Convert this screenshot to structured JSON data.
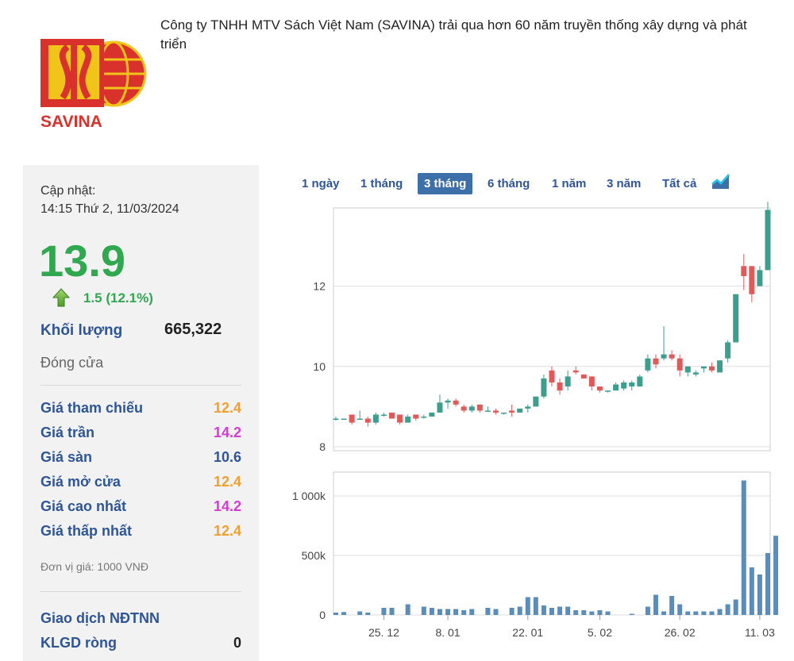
{
  "company": {
    "logo_text": "SAVINA",
    "description": "Công ty TNHH MTV Sách Việt Nam (SAVINA) trải qua hơn 60 năm truyền thống xây dựng và phát triển"
  },
  "quote": {
    "update_label": "Cập nhật:",
    "update_time": "14:15 Thứ 2, 11/03/2024",
    "price": "13.9",
    "change": "1.5 (12.1%)",
    "volume_label": "Khối lượng",
    "volume_value": "665,322",
    "close_label": "Đóng cửa",
    "rows": [
      {
        "label": "Giá tham chiếu",
        "value": "12.4",
        "color": "#f0a030"
      },
      {
        "label": "Giá trần",
        "value": "14.2",
        "color": "#d63bd6"
      },
      {
        "label": "Giá sàn",
        "value": "10.6",
        "color": "#2f5597"
      },
      {
        "label": "Giá mở cửa",
        "value": "12.4",
        "color": "#f0a030"
      },
      {
        "label": "Giá cao nhất",
        "value": "14.2",
        "color": "#d63bd6"
      },
      {
        "label": "Giá thấp nhất",
        "value": "12.4",
        "color": "#f0a030"
      }
    ],
    "unit": "Đơn vị giá: 1000 VNĐ",
    "foreign": {
      "title": "Giao dịch NĐTNN",
      "net_label": "KLGD ròng",
      "net_value": "0"
    }
  },
  "tabs": [
    "1 ngày",
    "1 tháng",
    "3 tháng",
    "6 tháng",
    "1 năm",
    "3 năm",
    "Tất cả"
  ],
  "active_tab": "3 tháng",
  "chart_type_icon": "area-chart-icon",
  "colors": {
    "up": "#3e9e8e",
    "down": "#e05a5a",
    "volume": "#5b8db8",
    "price_up": "#2fa84f"
  },
  "chart_data": {
    "type": "candlestick",
    "price_axis": {
      "ticks": [
        "8",
        "10",
        "12"
      ],
      "ylim": [
        7.9,
        13.95
      ]
    },
    "volume_axis": {
      "ticks": [
        "0",
        "500k",
        "1 000k"
      ],
      "ylim": [
        0,
        1200000
      ]
    },
    "date_ticks": [
      {
        "label": "25. 12",
        "index": 6
      },
      {
        "label": "8. 01",
        "index": 14
      },
      {
        "label": "22. 01",
        "index": 24
      },
      {
        "label": "5. 02",
        "index": 33
      },
      {
        "label": "26. 02",
        "index": 43
      },
      {
        "label": "11. 03",
        "index": 53
      }
    ],
    "candles": [
      [
        8.7,
        8.75,
        8.65,
        8.7
      ],
      [
        8.7,
        8.7,
        8.7,
        8.7
      ],
      [
        8.8,
        8.8,
        8.55,
        8.6
      ],
      [
        8.7,
        8.9,
        8.7,
        8.7
      ],
      [
        8.7,
        8.75,
        8.5,
        8.6
      ],
      [
        8.6,
        8.85,
        8.55,
        8.8
      ],
      [
        8.8,
        8.85,
        8.75,
        8.8
      ],
      [
        8.85,
        8.85,
        8.7,
        8.7
      ],
      [
        8.8,
        8.8,
        8.55,
        8.6
      ],
      [
        8.6,
        8.8,
        8.6,
        8.75
      ],
      [
        8.8,
        8.8,
        8.65,
        8.7
      ],
      [
        8.75,
        8.8,
        8.7,
        8.75
      ],
      [
        8.75,
        8.85,
        8.75,
        8.85
      ],
      [
        8.85,
        9.3,
        8.85,
        9.1
      ],
      [
        9.1,
        9.2,
        8.95,
        9.15
      ],
      [
        9.15,
        9.2,
        9.0,
        9.05
      ],
      [
        9.0,
        9.05,
        8.85,
        8.9
      ],
      [
        8.9,
        9.05,
        8.85,
        9.0
      ],
      [
        9.05,
        9.05,
        8.85,
        8.9
      ],
      [
        8.9,
        9.0,
        8.9,
        8.9
      ],
      [
        8.9,
        8.95,
        8.8,
        8.85
      ],
      [
        8.85,
        8.85,
        8.8,
        8.85
      ],
      [
        8.9,
        9.05,
        8.75,
        8.85
      ],
      [
        8.85,
        8.95,
        8.85,
        8.95
      ],
      [
        8.95,
        9.05,
        8.85,
        9.0
      ],
      [
        9.0,
        9.25,
        9.0,
        9.25
      ],
      [
        9.25,
        9.8,
        9.2,
        9.7
      ],
      [
        9.9,
        10.0,
        9.5,
        9.6
      ],
      [
        9.6,
        9.7,
        9.3,
        9.4
      ],
      [
        9.5,
        9.9,
        9.4,
        9.75
      ],
      [
        9.9,
        10.0,
        9.8,
        9.85
      ],
      [
        9.8,
        9.8,
        9.7,
        9.7
      ],
      [
        9.75,
        9.75,
        9.4,
        9.5
      ],
      [
        9.5,
        9.5,
        9.35,
        9.4
      ],
      [
        9.4,
        9.4,
        9.35,
        9.4
      ],
      [
        9.4,
        9.6,
        9.4,
        9.55
      ],
      [
        9.45,
        9.65,
        9.4,
        9.6
      ],
      [
        9.5,
        9.65,
        9.4,
        9.6
      ],
      [
        9.5,
        9.8,
        9.5,
        9.75
      ],
      [
        9.9,
        10.3,
        9.85,
        10.2
      ],
      [
        10.2,
        10.3,
        9.95,
        10.05
      ],
      [
        10.2,
        11.0,
        10.15,
        10.3
      ],
      [
        10.3,
        10.4,
        10.15,
        10.2
      ],
      [
        10.2,
        10.3,
        9.75,
        9.9
      ],
      [
        9.85,
        10.0,
        9.75,
        10.0
      ],
      [
        9.8,
        9.9,
        9.75,
        9.85
      ],
      [
        9.95,
        10.0,
        9.85,
        10.0
      ],
      [
        10.0,
        10.1,
        9.85,
        9.9
      ],
      [
        9.85,
        10.15,
        9.85,
        10.15
      ],
      [
        10.2,
        10.65,
        10.1,
        10.6
      ],
      [
        10.6,
        11.8,
        10.6,
        11.8
      ],
      [
        12.5,
        12.8,
        11.9,
        12.25
      ],
      [
        12.5,
        12.5,
        11.6,
        11.8
      ],
      [
        12.0,
        12.5,
        12.0,
        12.4
      ],
      [
        12.4,
        14.1,
        12.4,
        13.9
      ]
    ],
    "volume": [
      20000,
      25000,
      0,
      30000,
      20000,
      0,
      60000,
      60000,
      0,
      90000,
      0,
      70000,
      60000,
      50000,
      50000,
      50000,
      40000,
      50000,
      0,
      60000,
      50000,
      0,
      60000,
      70000,
      150000,
      150000,
      80000,
      60000,
      70000,
      70000,
      40000,
      40000,
      30000,
      40000,
      30000,
      0,
      0,
      10000,
      0,
      70000,
      170000,
      30000,
      160000,
      90000,
      30000,
      30000,
      30000,
      30000,
      50000,
      90000,
      130000,
      1130000,
      400000,
      340000,
      520000,
      665322
    ]
  }
}
